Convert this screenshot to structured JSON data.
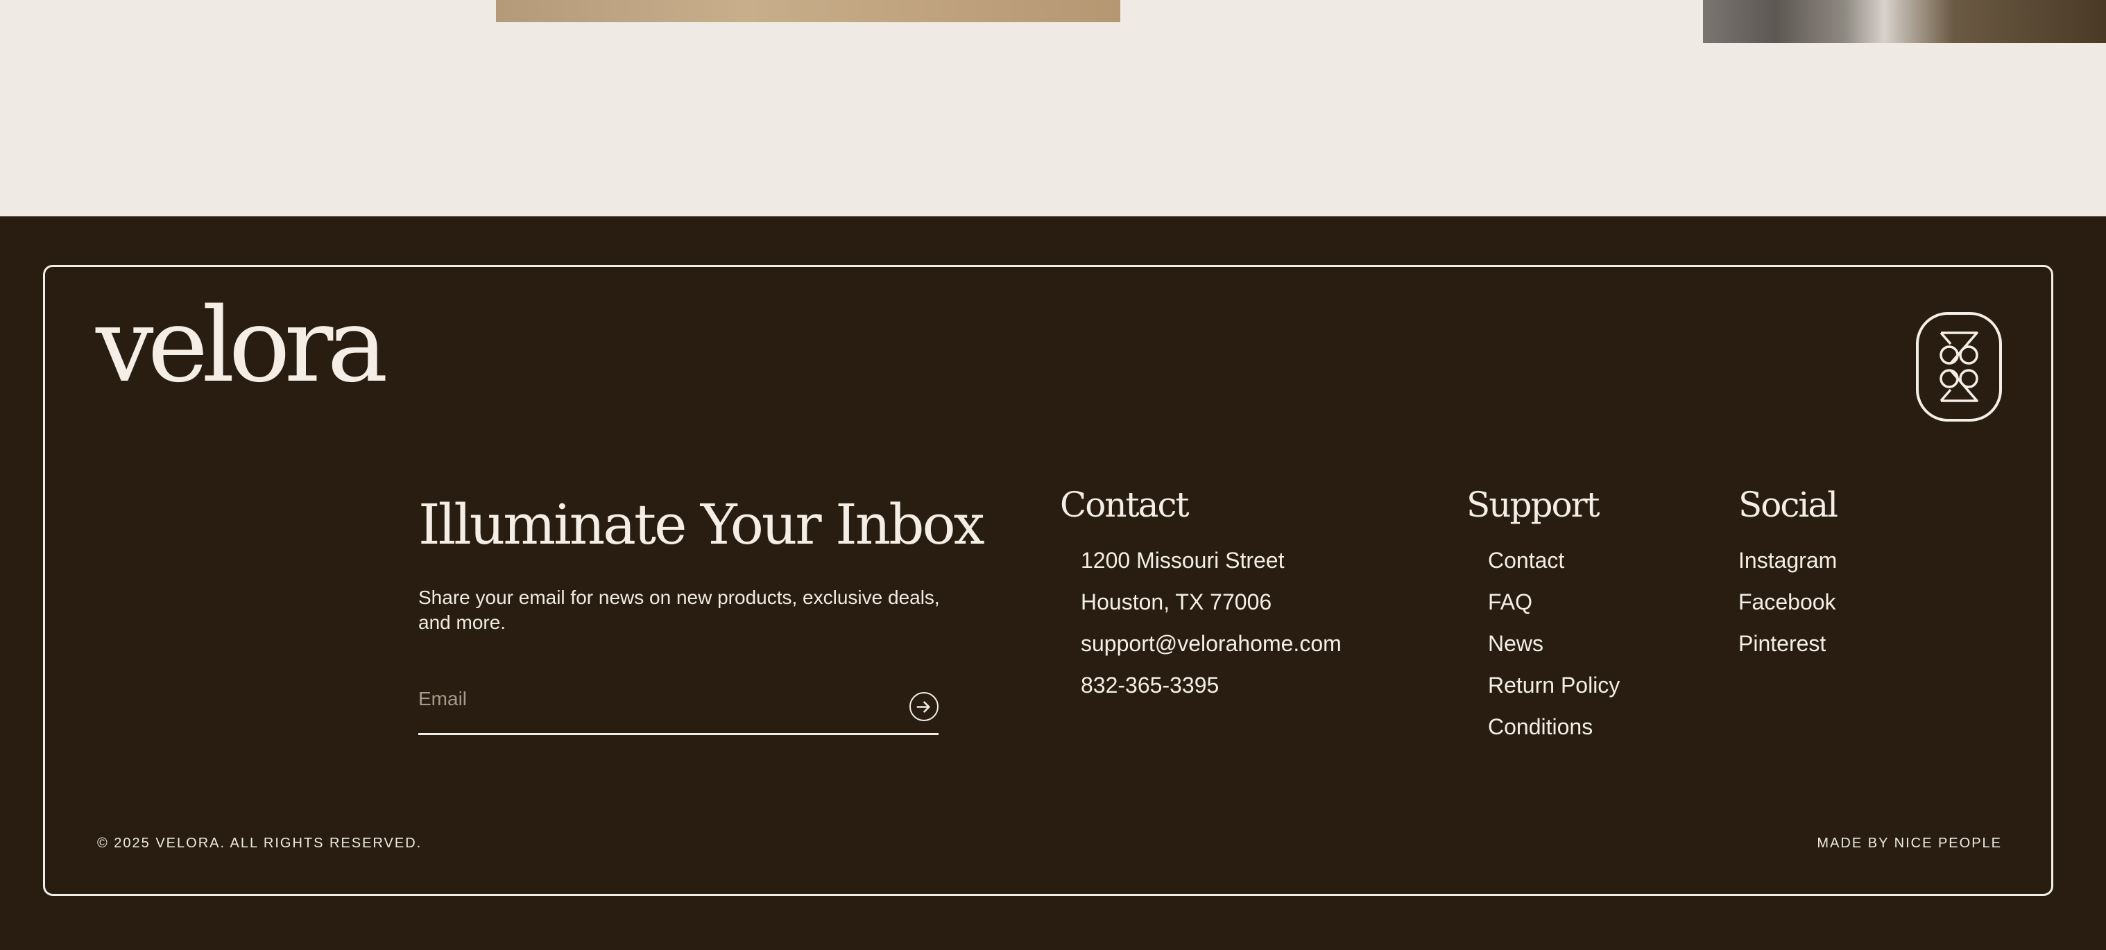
{
  "brand": {
    "logo_text": "velora",
    "background": "#281d10",
    "foreground": "#f4eee6",
    "page_background": "#efeae3"
  },
  "newsletter": {
    "title": "Illuminate Your Inbox",
    "description": "Share your email for news on new products, exclusive deals, and more.",
    "email_placeholder": "Email",
    "submit_icon": "arrow-right-circle-icon"
  },
  "contact": {
    "heading": "Contact",
    "lines": [
      "1200 Missouri Street",
      "Houston, TX 77006",
      "support@velorahome.com",
      "832-365-3395"
    ]
  },
  "support": {
    "heading": "Support",
    "links": [
      "Contact",
      "FAQ",
      "News",
      "Return Policy",
      "Conditions"
    ]
  },
  "social": {
    "heading": "Social",
    "links": [
      "Instagram",
      "Facebook",
      "Pinterest"
    ]
  },
  "legal": {
    "copyright": "© 2025 VELORA. ALL RIGHTS RESERVED.",
    "credit": "MADE BY NICE PEOPLE"
  },
  "emblem_icon": "brand-emblem-icon"
}
